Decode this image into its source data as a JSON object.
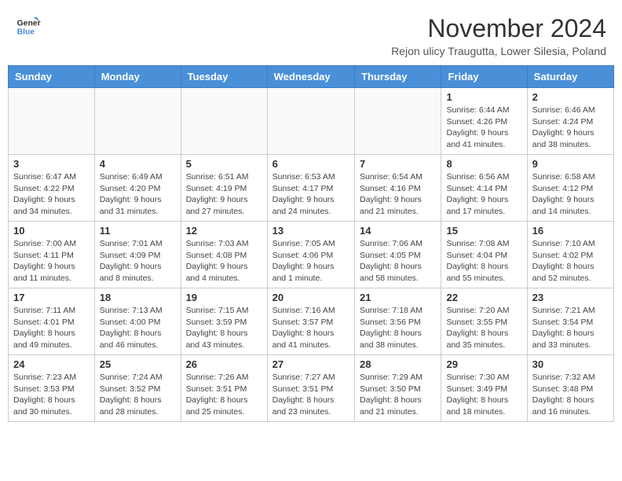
{
  "logo": {
    "line1": "General",
    "line2": "Blue"
  },
  "title": "November 2024",
  "subtitle": "Rejon ulicy Traugutta, Lower Silesia, Poland",
  "days_of_week": [
    "Sunday",
    "Monday",
    "Tuesday",
    "Wednesday",
    "Thursday",
    "Friday",
    "Saturday"
  ],
  "weeks": [
    [
      {
        "day": "",
        "info": ""
      },
      {
        "day": "",
        "info": ""
      },
      {
        "day": "",
        "info": ""
      },
      {
        "day": "",
        "info": ""
      },
      {
        "day": "",
        "info": ""
      },
      {
        "day": "1",
        "info": "Sunrise: 6:44 AM\nSunset: 4:26 PM\nDaylight: 9 hours and 41 minutes."
      },
      {
        "day": "2",
        "info": "Sunrise: 6:46 AM\nSunset: 4:24 PM\nDaylight: 9 hours and 38 minutes."
      }
    ],
    [
      {
        "day": "3",
        "info": "Sunrise: 6:47 AM\nSunset: 4:22 PM\nDaylight: 9 hours and 34 minutes."
      },
      {
        "day": "4",
        "info": "Sunrise: 6:49 AM\nSunset: 4:20 PM\nDaylight: 9 hours and 31 minutes."
      },
      {
        "day": "5",
        "info": "Sunrise: 6:51 AM\nSunset: 4:19 PM\nDaylight: 9 hours and 27 minutes."
      },
      {
        "day": "6",
        "info": "Sunrise: 6:53 AM\nSunset: 4:17 PM\nDaylight: 9 hours and 24 minutes."
      },
      {
        "day": "7",
        "info": "Sunrise: 6:54 AM\nSunset: 4:16 PM\nDaylight: 9 hours and 21 minutes."
      },
      {
        "day": "8",
        "info": "Sunrise: 6:56 AM\nSunset: 4:14 PM\nDaylight: 9 hours and 17 minutes."
      },
      {
        "day": "9",
        "info": "Sunrise: 6:58 AM\nSunset: 4:12 PM\nDaylight: 9 hours and 14 minutes."
      }
    ],
    [
      {
        "day": "10",
        "info": "Sunrise: 7:00 AM\nSunset: 4:11 PM\nDaylight: 9 hours and 11 minutes."
      },
      {
        "day": "11",
        "info": "Sunrise: 7:01 AM\nSunset: 4:09 PM\nDaylight: 9 hours and 8 minutes."
      },
      {
        "day": "12",
        "info": "Sunrise: 7:03 AM\nSunset: 4:08 PM\nDaylight: 9 hours and 4 minutes."
      },
      {
        "day": "13",
        "info": "Sunrise: 7:05 AM\nSunset: 4:06 PM\nDaylight: 9 hours and 1 minute."
      },
      {
        "day": "14",
        "info": "Sunrise: 7:06 AM\nSunset: 4:05 PM\nDaylight: 8 hours and 58 minutes."
      },
      {
        "day": "15",
        "info": "Sunrise: 7:08 AM\nSunset: 4:04 PM\nDaylight: 8 hours and 55 minutes."
      },
      {
        "day": "16",
        "info": "Sunrise: 7:10 AM\nSunset: 4:02 PM\nDaylight: 8 hours and 52 minutes."
      }
    ],
    [
      {
        "day": "17",
        "info": "Sunrise: 7:11 AM\nSunset: 4:01 PM\nDaylight: 8 hours and 49 minutes."
      },
      {
        "day": "18",
        "info": "Sunrise: 7:13 AM\nSunset: 4:00 PM\nDaylight: 8 hours and 46 minutes."
      },
      {
        "day": "19",
        "info": "Sunrise: 7:15 AM\nSunset: 3:59 PM\nDaylight: 8 hours and 43 minutes."
      },
      {
        "day": "20",
        "info": "Sunrise: 7:16 AM\nSunset: 3:57 PM\nDaylight: 8 hours and 41 minutes."
      },
      {
        "day": "21",
        "info": "Sunrise: 7:18 AM\nSunset: 3:56 PM\nDaylight: 8 hours and 38 minutes."
      },
      {
        "day": "22",
        "info": "Sunrise: 7:20 AM\nSunset: 3:55 PM\nDaylight: 8 hours and 35 minutes."
      },
      {
        "day": "23",
        "info": "Sunrise: 7:21 AM\nSunset: 3:54 PM\nDaylight: 8 hours and 33 minutes."
      }
    ],
    [
      {
        "day": "24",
        "info": "Sunrise: 7:23 AM\nSunset: 3:53 PM\nDaylight: 8 hours and 30 minutes."
      },
      {
        "day": "25",
        "info": "Sunrise: 7:24 AM\nSunset: 3:52 PM\nDaylight: 8 hours and 28 minutes."
      },
      {
        "day": "26",
        "info": "Sunrise: 7:26 AM\nSunset: 3:51 PM\nDaylight: 8 hours and 25 minutes."
      },
      {
        "day": "27",
        "info": "Sunrise: 7:27 AM\nSunset: 3:51 PM\nDaylight: 8 hours and 23 minutes."
      },
      {
        "day": "28",
        "info": "Sunrise: 7:29 AM\nSunset: 3:50 PM\nDaylight: 8 hours and 21 minutes."
      },
      {
        "day": "29",
        "info": "Sunrise: 7:30 AM\nSunset: 3:49 PM\nDaylight: 8 hours and 18 minutes."
      },
      {
        "day": "30",
        "info": "Sunrise: 7:32 AM\nSunset: 3:48 PM\nDaylight: 8 hours and 16 minutes."
      }
    ]
  ]
}
